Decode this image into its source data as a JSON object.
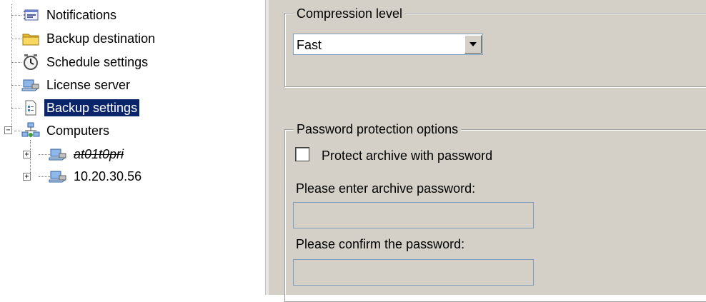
{
  "tree": {
    "items": [
      {
        "label": "Notifications",
        "icon": "notifications-icon"
      },
      {
        "label": "Backup destination",
        "icon": "folder-icon"
      },
      {
        "label": "Schedule settings",
        "icon": "clock-icon"
      },
      {
        "label": "License server",
        "icon": "computer-icon"
      },
      {
        "label": "Backup settings",
        "icon": "settings-document-icon",
        "selected": true
      },
      {
        "label": "Computers",
        "icon": "network-icon",
        "expanded": true
      },
      {
        "label": "at01t0pri",
        "icon": "computer-icon",
        "expander": "+",
        "struck": true
      },
      {
        "label": "10.20.30.56",
        "icon": "computer-icon",
        "expander": "+"
      }
    ],
    "computers_expander": "−"
  },
  "compression": {
    "legend": "Compression level",
    "selected": "Fast"
  },
  "password": {
    "legend": "Password protection options",
    "checkbox_label": "Protect archive with password",
    "checked": false,
    "enter_label": "Please enter archive password:",
    "confirm_label": "Please confirm the password:"
  },
  "colors": {
    "selection": "#0a246a",
    "panel_background": "#d4d0c8"
  }
}
